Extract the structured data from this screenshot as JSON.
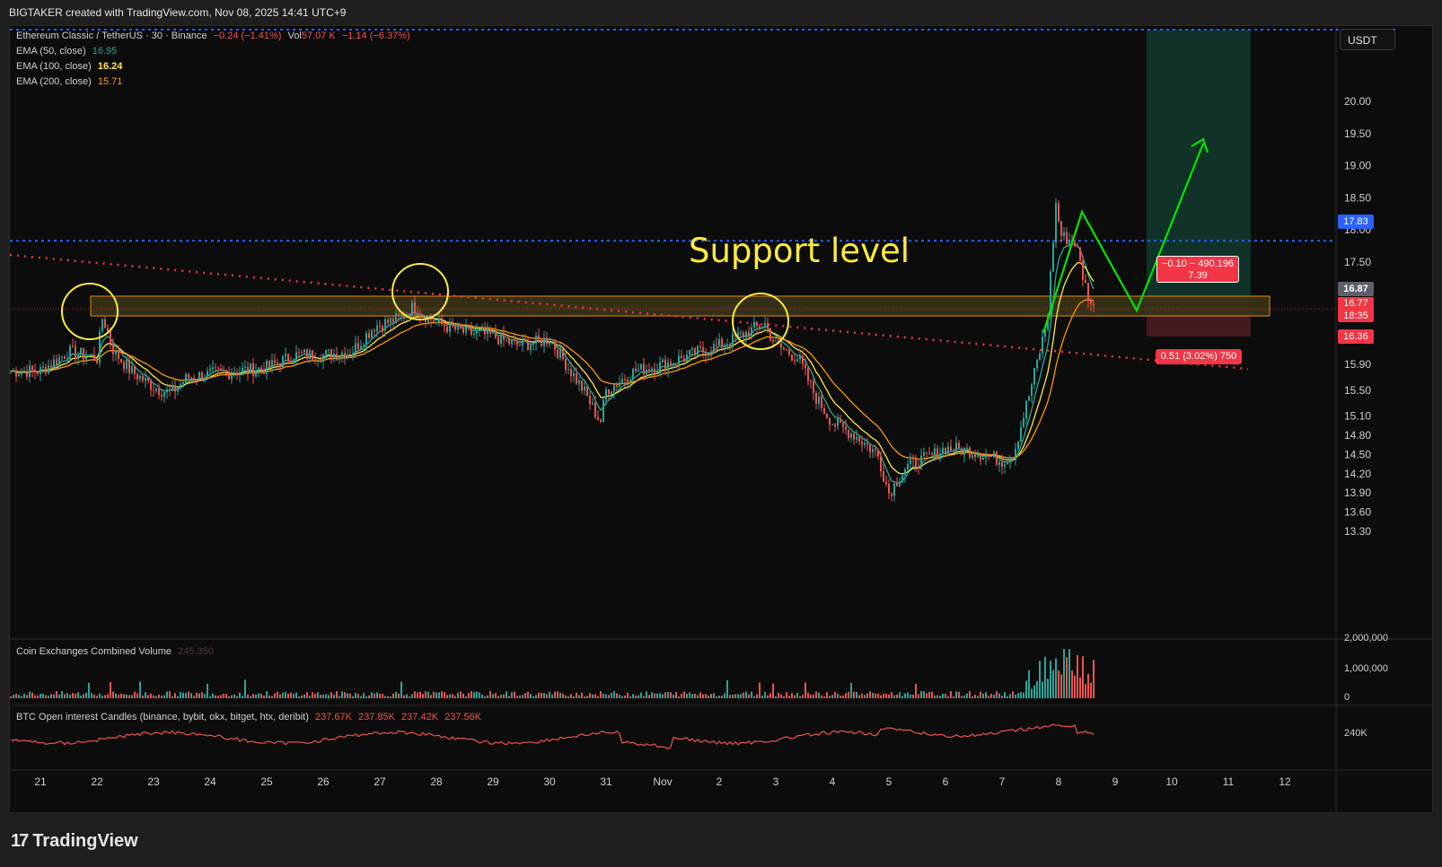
{
  "header": {
    "title": "BIGTAKER created with TradingView.com, Nov 08, 2025 14:41 UTC+9"
  },
  "symbol": {
    "name": "Ethereum Classic / TetherUS · 30 · Binance",
    "change": "−0.24 (−1.41%)",
    "vol_label": "Vol",
    "vol_value": "57.07 K",
    "vol_change": "−1.14 (−6.37%)"
  },
  "indicators": [
    {
      "label": "EMA (50, close)",
      "value": "16.95",
      "color": "#26a69a"
    },
    {
      "label": "EMA (100, close)",
      "value": "16.24",
      "color": "#ffeb3b"
    },
    {
      "label": "EMA (200, close)",
      "value": "15.71",
      "color": "#ff9800"
    }
  ],
  "currency_button": "USDT",
  "annotation": {
    "text": "Support level",
    "color": "#ffeb3b"
  },
  "price_labels": {
    "blue_line": "17.83",
    "last_price": "16.87",
    "current_price": "16.77",
    "countdown": "18:35",
    "stop": "16.36"
  },
  "position_box": {
    "target_line1": "−0.10 − 490.196",
    "target_line2": "7.39",
    "stop_label": "0.51 (3.02%) 750"
  },
  "volume_pane": {
    "label": "Coin Exchanges Combined Volume",
    "value": "245,350",
    "ticks": [
      "2,000,000",
      "1,000,000",
      "0"
    ]
  },
  "oi_pane": {
    "label": "BTC Open interest Candles (binance, bybit, okx, bitget, htx, deribit)",
    "values": [
      "237.67K",
      "237.85K",
      "237.42K",
      "237.56K"
    ],
    "tick": "240K"
  },
  "x_axis": [
    "21",
    "22",
    "23",
    "24",
    "25",
    "26",
    "27",
    "28",
    "29",
    "30",
    "31",
    "Nov",
    "2",
    "3",
    "4",
    "5",
    "6",
    "7",
    "8",
    "9",
    "10",
    "11",
    "12"
  ],
  "brand": "TradingView",
  "colors": {
    "up": "#26a69a",
    "down": "#ef5350",
    "blue_dotted": "#2962ff",
    "red_dotted": "#f23645",
    "arrow": "#00e600"
  },
  "chart_data": {
    "type": "candlestick",
    "y_axis_ticks": [
      "20.00",
      "19.50",
      "19.00",
      "18.50",
      "18.00",
      "17.50",
      "17.10",
      "15.90",
      "15.50",
      "15.10",
      "14.80",
      "14.50",
      "14.20",
      "13.90",
      "13.60",
      "13.30"
    ],
    "ylim": [
      13.0,
      20.6
    ],
    "horizontal_levels": {
      "blue_dotted_top": 20.6,
      "blue_dotted": 17.83,
      "support_zone": [
        16.7,
        16.97
      ]
    },
    "close_path": [
      [
        "21",
        15.8
      ],
      [
        "21.5",
        16.1
      ],
      [
        "22",
        16.0
      ],
      [
        "22.1",
        16.65
      ],
      [
        "22.3",
        16.1
      ],
      [
        "22.6",
        15.8
      ],
      [
        "23",
        15.55
      ],
      [
        "23.3",
        15.45
      ],
      [
        "23.6",
        15.7
      ],
      [
        "24",
        15.75
      ],
      [
        "24.5",
        15.8
      ],
      [
        "25",
        15.85
      ],
      [
        "25.5",
        16.05
      ],
      [
        "26",
        16.05
      ],
      [
        "26.5",
        16.1
      ],
      [
        "26.9",
        16.5
      ],
      [
        "27.3",
        16.6
      ],
      [
        "27.6",
        16.8
      ],
      [
        "28",
        16.55
      ],
      [
        "28.5",
        16.4
      ],
      [
        "29",
        16.35
      ],
      [
        "29.4",
        16.2
      ],
      [
        "29.8",
        16.25
      ],
      [
        "30",
        16.3
      ],
      [
        "30.3",
        15.9
      ],
      [
        "30.6",
        15.5
      ],
      [
        "30.9",
        15.0
      ],
      [
        "31",
        15.5
      ],
      [
        "31.5",
        15.8
      ],
      [
        "Nov",
        15.9
      ],
      [
        "2",
        16.2
      ],
      [
        "2.5",
        16.4
      ],
      [
        "2.8",
        16.55
      ],
      [
        "3",
        16.2
      ],
      [
        "3.4",
        16.0
      ],
      [
        "3.7",
        15.4
      ],
      [
        "4",
        15.0
      ],
      [
        "4.4",
        14.8
      ],
      [
        "4.8",
        14.5
      ],
      [
        "5",
        13.9
      ],
      [
        "5.3",
        14.3
      ],
      [
        "5.7",
        14.45
      ],
      [
        "6",
        14.6
      ],
      [
        "6.5",
        14.55
      ],
      [
        "7",
        14.4
      ],
      [
        "7.2",
        14.5
      ],
      [
        "7.5",
        15.5
      ],
      [
        "7.8",
        16.6
      ],
      [
        "7.95",
        18.4
      ],
      [
        "8.05",
        17.9
      ],
      [
        "8.3",
        17.8
      ],
      [
        "8.45",
        17.2
      ],
      [
        "8.6",
        16.77
      ]
    ],
    "projection": [
      [
        "8.6",
        16.77
      ],
      [
        "9.3",
        16.6
      ],
      [
        "10.5",
        18.9
      ]
    ],
    "ema50_end": 16.95,
    "ema100_end": 16.24,
    "ema200_end": 15.71
  }
}
